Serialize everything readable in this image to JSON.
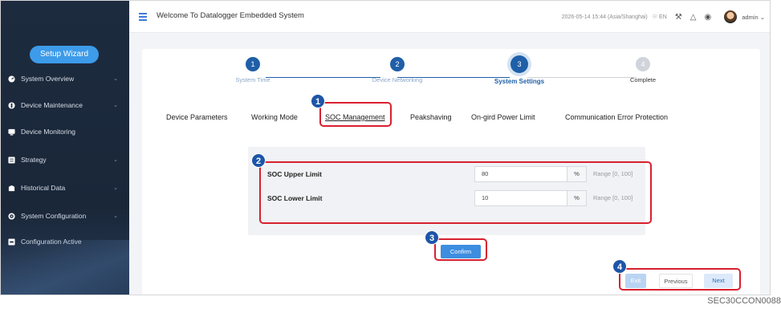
{
  "header": {
    "title": "Welcome To Datalogger Embedded System",
    "datetime": "2026-05-14 15:44 (Asia/Shanghai)",
    "language": "EN",
    "user": "admin"
  },
  "sidebar": {
    "wizard_label": "Setup Wizard",
    "items": [
      {
        "label": "System Overview",
        "icon": "dashboard-icon",
        "has_children": true
      },
      {
        "label": "Device Maintenance",
        "icon": "wrench-icon",
        "has_children": true
      },
      {
        "label": "Device Monitoring",
        "icon": "monitor-icon",
        "has_children": false
      },
      {
        "label": "Strategy",
        "icon": "strategy-icon",
        "has_children": true
      },
      {
        "label": "Historical Data",
        "icon": "history-icon",
        "has_children": true
      },
      {
        "label": "System Configuration",
        "icon": "settings-icon",
        "has_children": true
      },
      {
        "label": "Configuration Active",
        "icon": "config-icon",
        "has_children": false
      }
    ]
  },
  "steps": [
    {
      "number": "1",
      "label": "System Time",
      "state": "done"
    },
    {
      "number": "2",
      "label": "Device Networking",
      "state": "done"
    },
    {
      "number": "3",
      "label": "System Settings",
      "state": "active"
    },
    {
      "number": "4",
      "label": "Complete",
      "state": "todo"
    }
  ],
  "tabs": [
    {
      "label": "Device Parameters"
    },
    {
      "label": "Working Mode"
    },
    {
      "label": "SOC Management",
      "active": true
    },
    {
      "label": "Peakshaving"
    },
    {
      "label": "On-gird Power Limit"
    },
    {
      "label": "Communication Error Protection"
    }
  ],
  "form": {
    "rows": [
      {
        "label": "SOC Upper Limit",
        "value": "80",
        "unit": "%",
        "range": "Range [0, 100]"
      },
      {
        "label": "SOC Lower Limit",
        "value": "10",
        "unit": "%",
        "range": "Range [0, 100]"
      }
    ]
  },
  "buttons": {
    "confirm": "Confirm",
    "exit": "Exit",
    "previous": "Previous",
    "next": "Next"
  },
  "annotations": [
    "1",
    "2",
    "3",
    "4"
  ],
  "figure_code": "SEC30CCON0088",
  "colors": {
    "sidebar_bg": "#1d2b3f",
    "accent": "#1f5fa8",
    "highlight": "#d8202f",
    "button": "#3d8ee0"
  }
}
